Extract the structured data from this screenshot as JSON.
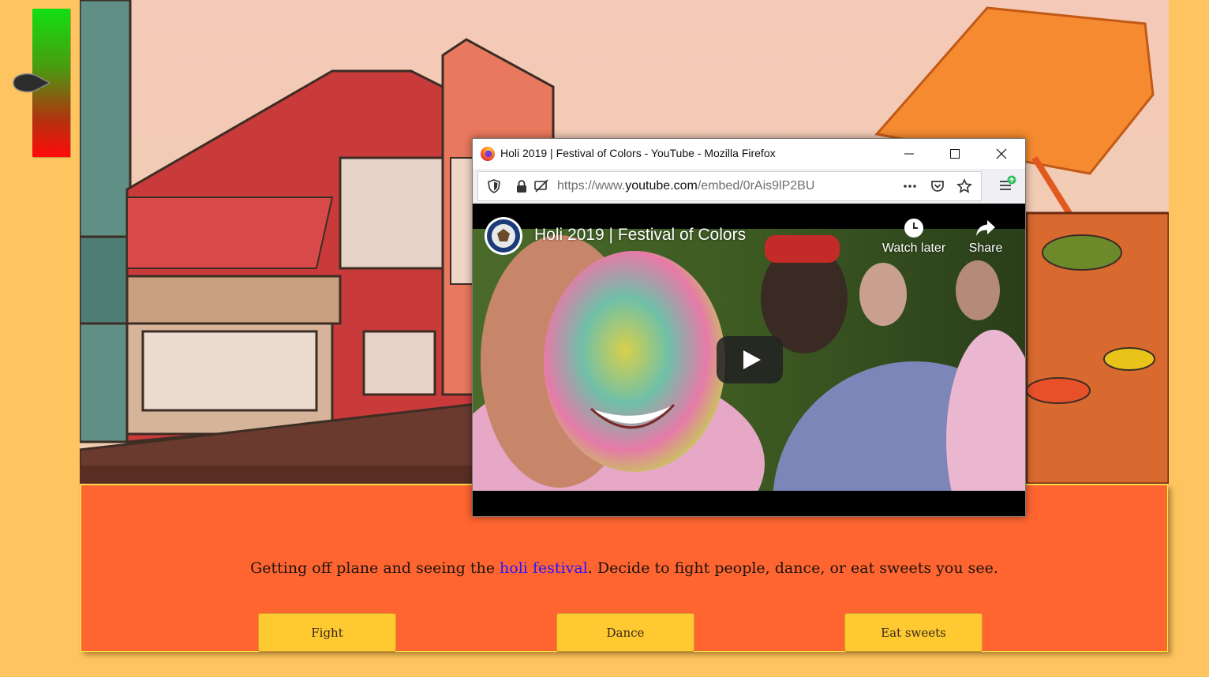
{
  "meter": {
    "level": 0.5,
    "top_color": "#11e011",
    "bottom_color": "#ff0a0a"
  },
  "story": {
    "text_before": "Getting off plane and seeing the ",
    "link_text": "holi festival",
    "text_after": ". Decide to fight people, dance, or eat sweets you see.",
    "choices": [
      "Fight",
      "Dance",
      "Eat sweets"
    ]
  },
  "browser": {
    "window_title": "Holi 2019 | Festival of Colors - YouTube - Mozilla Firefox",
    "url_prefix": "https://www.",
    "url_domain": "youtube.com",
    "url_path": "/embed/0rAis9lP2BU",
    "icons": [
      "firefox-logo",
      "minimize",
      "maximize",
      "close",
      "shield",
      "lock",
      "permissions",
      "more",
      "pocket",
      "star",
      "menu"
    ]
  },
  "video": {
    "title": "Holi 2019 | Festival of Colors",
    "watch_later_label": "Watch later",
    "share_label": "Share"
  },
  "colors": {
    "page_bg": "#fdc45f",
    "panel_bg": "#ff6530",
    "button_bg": "#ffc932",
    "link": "#2a16ff"
  }
}
